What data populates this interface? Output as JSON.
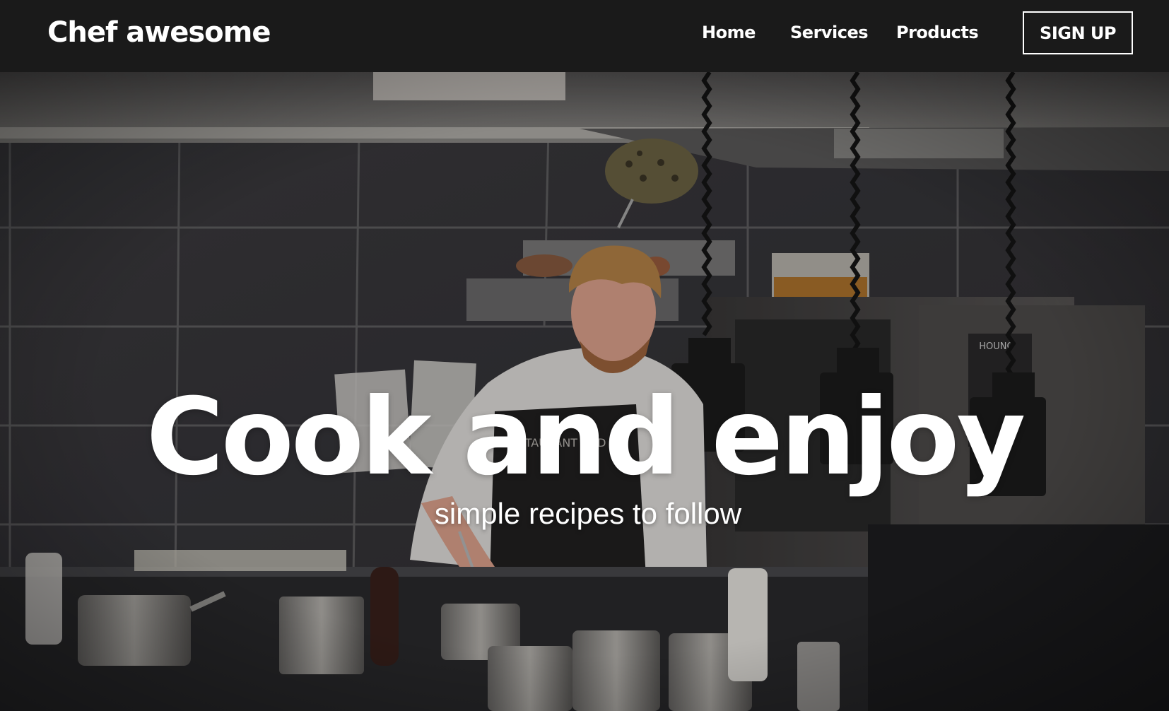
{
  "header": {
    "brand": "Chef awesome",
    "nav": {
      "home": "Home",
      "services": "Services",
      "products": "Products"
    },
    "signup_label": "SIGN UP"
  },
  "hero": {
    "title": "Cook and enjoy",
    "subtitle": "simple recipes to follow",
    "background_image": "chef-kitchen-photo"
  },
  "colors": {
    "navbar_bg": "#1a1a1a",
    "text": "#ffffff"
  }
}
